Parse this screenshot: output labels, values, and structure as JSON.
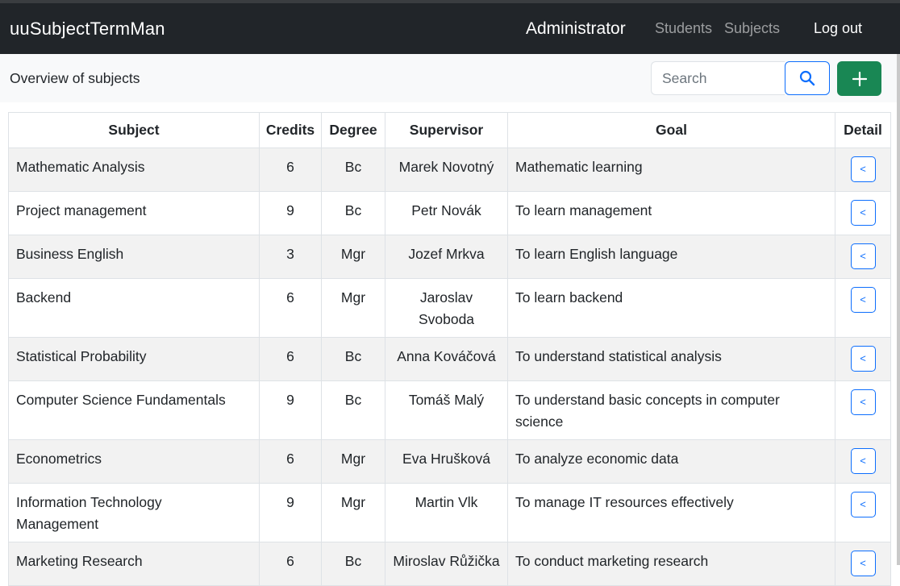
{
  "navbar": {
    "brand": "uuSubjectTermMan",
    "role": "Administrator",
    "links": [
      "Students",
      "Subjects"
    ],
    "logout": "Log out"
  },
  "subbar": {
    "title": "Overview of subjects",
    "search_placeholder": "Search"
  },
  "colors": {
    "navbar_bg": "#212529",
    "primary": "#0d6efd",
    "success": "#198754"
  },
  "icons": {
    "search": "search-icon",
    "add": "plus-icon",
    "detail": "chevron-left-icon"
  },
  "table": {
    "headers": [
      "Subject",
      "Credits",
      "Degree",
      "Supervisor",
      "Goal",
      "Detail"
    ],
    "detail_label": "<",
    "rows": [
      {
        "subject": "Mathematic Analysis",
        "credits": "6",
        "degree": "Bc",
        "supervisor": "Marek Novotný",
        "goal": "Mathematic learning"
      },
      {
        "subject": "Project management",
        "credits": "9",
        "degree": "Bc",
        "supervisor": "Petr Novák",
        "goal": "To learn management"
      },
      {
        "subject": "Business English",
        "credits": "3",
        "degree": "Mgr",
        "supervisor": "Jozef Mrkva",
        "goal": "To learn English language"
      },
      {
        "subject": "Backend",
        "credits": "6",
        "degree": "Mgr",
        "supervisor": "Jaroslav Svoboda",
        "goal": "To learn backend"
      },
      {
        "subject": "Statistical Probability",
        "credits": "6",
        "degree": "Bc",
        "supervisor": "Anna Kováčová",
        "goal": "To understand statistical analysis"
      },
      {
        "subject": "Computer Science Fundamentals",
        "credits": "9",
        "degree": "Bc",
        "supervisor": "Tomáš Malý",
        "goal": "To understand basic concepts in computer science"
      },
      {
        "subject": "Econometrics",
        "credits": "6",
        "degree": "Mgr",
        "supervisor": "Eva Hrušková",
        "goal": "To analyze economic data"
      },
      {
        "subject": "Information Technology Management",
        "credits": "9",
        "degree": "Mgr",
        "supervisor": "Martin Vlk",
        "goal": "To manage IT resources effectively"
      },
      {
        "subject": "Marketing Research",
        "credits": "6",
        "degree": "Bc",
        "supervisor": "Miroslav Růžička",
        "goal": "To conduct marketing research"
      }
    ]
  }
}
